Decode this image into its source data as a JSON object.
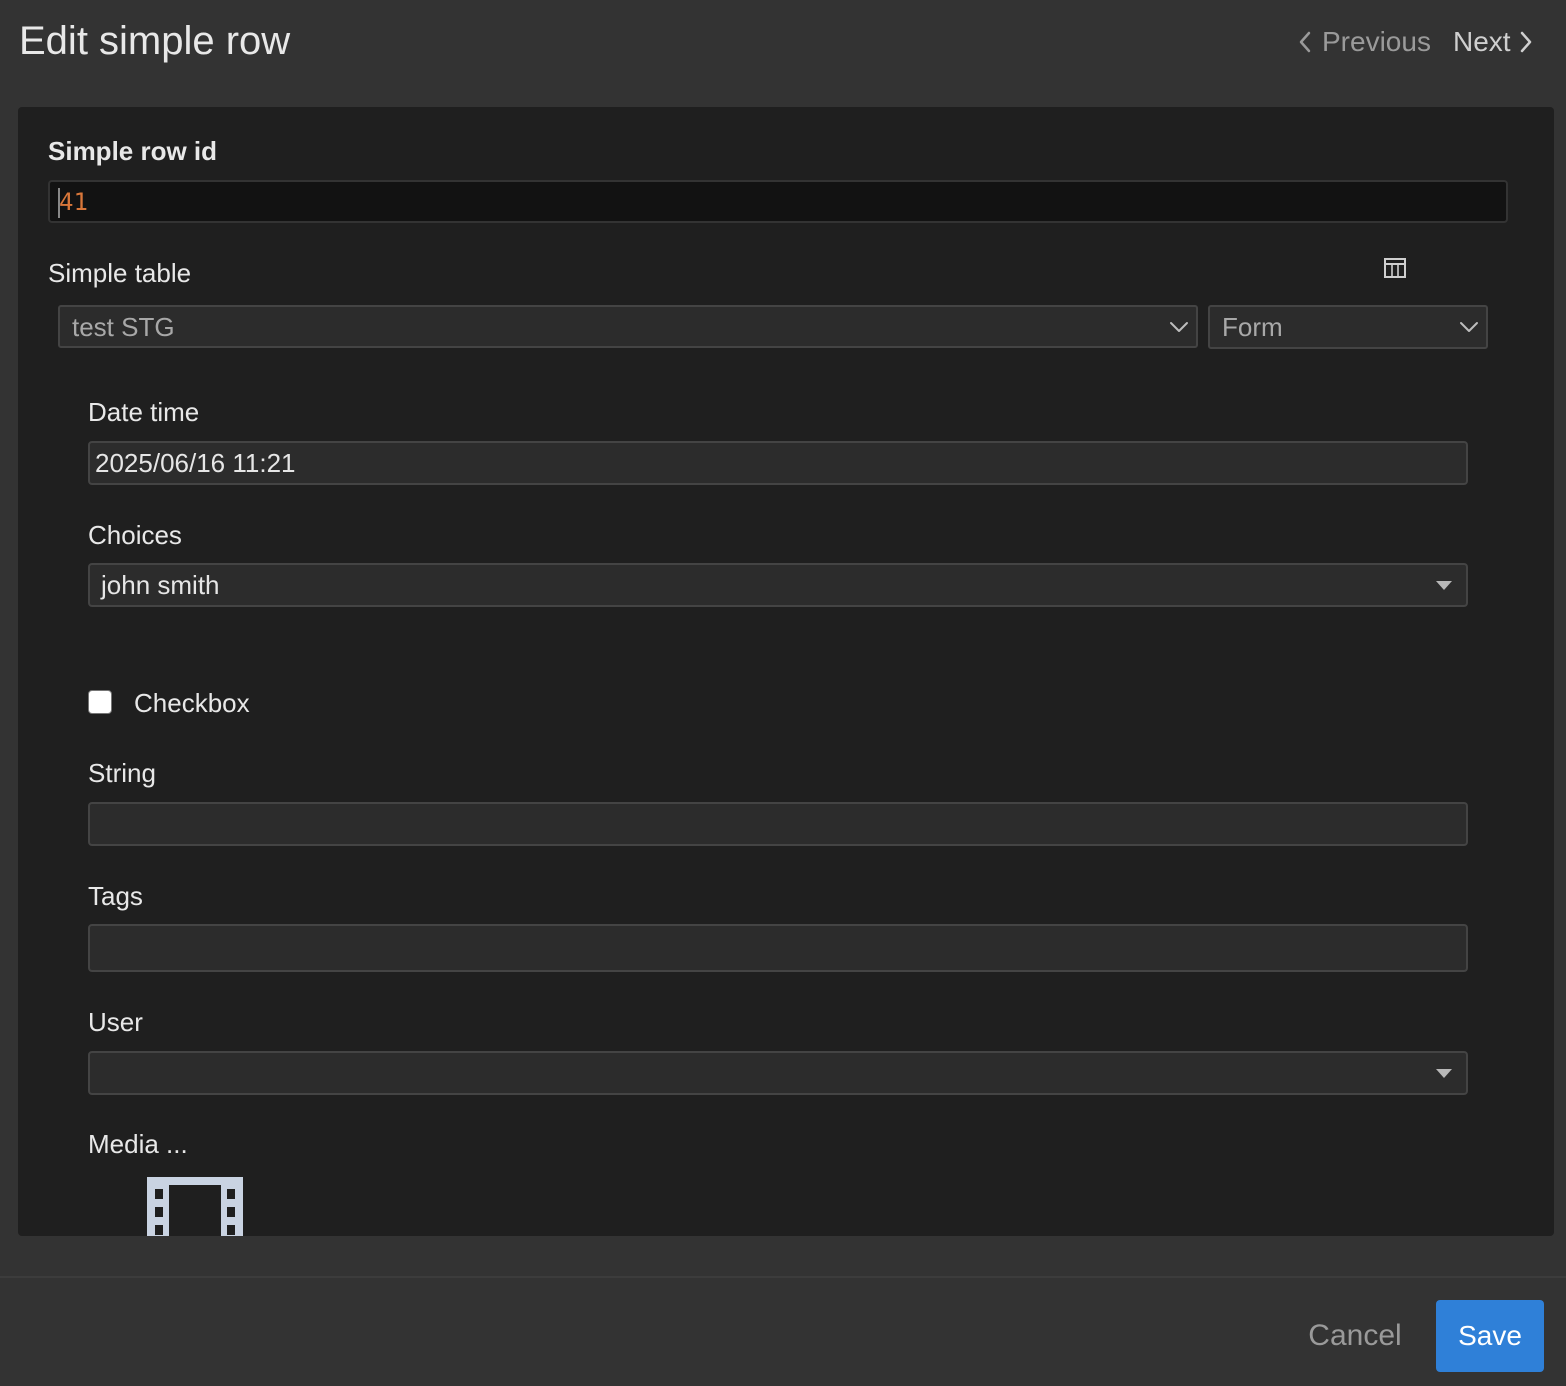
{
  "header": {
    "title": "Edit simple row",
    "previous_label": "Previous",
    "next_label": "Next"
  },
  "form": {
    "row_id": {
      "label": "Simple row id",
      "value": "41"
    },
    "table": {
      "label": "Simple table",
      "selected": "test STG",
      "view_selected": "Form",
      "view_icon": "table-icon"
    },
    "date_time": {
      "label": "Date time",
      "value": "2025/06/16 11:21"
    },
    "choices": {
      "label": "Choices",
      "value": "john smith"
    },
    "checkbox": {
      "label": "Checkbox",
      "checked": false
    },
    "string": {
      "label": "String",
      "value": ""
    },
    "tags": {
      "label": "Tags",
      "value": ""
    },
    "user": {
      "label": "User",
      "value": ""
    },
    "media": {
      "label": "Media ...",
      "icon": "film-icon"
    }
  },
  "footer": {
    "cancel_label": "Cancel",
    "save_label": "Save",
    "save_color": "#2f80d8"
  }
}
